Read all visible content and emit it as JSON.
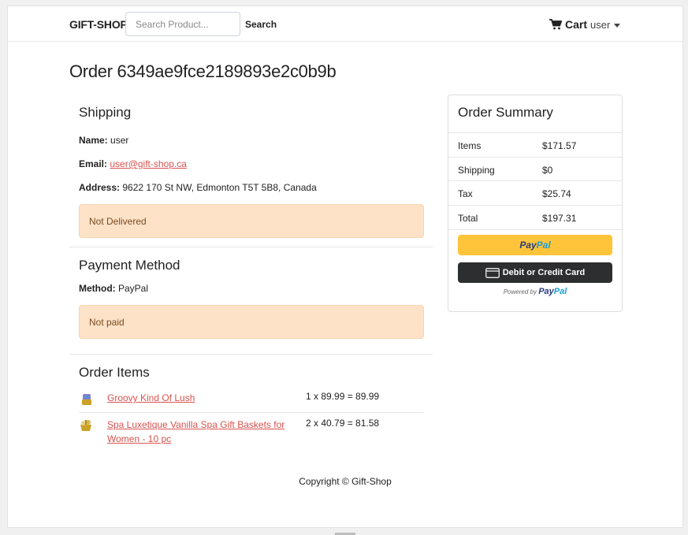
{
  "navbar": {
    "brand": "GIFT-SHOP",
    "search_placeholder": "Search Product...",
    "search_label": "Search",
    "cart_label": "Cart",
    "user_label": "user"
  },
  "order": {
    "title": "Order 6349ae9fce2189893e2c0b9b"
  },
  "shipping": {
    "heading": "Shipping",
    "name_label": "Name:",
    "name_value": "user",
    "email_label": "Email:",
    "email_value": "user@gift-shop.ca",
    "address_label": "Address:",
    "address_value": "9622 170 St NW, Edmonton T5T 5B8, Canada",
    "status": "Not Delivered"
  },
  "payment": {
    "heading": "Payment Method",
    "method_label": "Method:",
    "method_value": "PayPal",
    "status": "Not paid"
  },
  "items": {
    "heading": "Order Items",
    "list": [
      {
        "name": "Groovy Kind Of Lush",
        "calc": "1 x 89.99 = 89.99",
        "icon": "product-thumbnail"
      },
      {
        "name": "Spa Luxetique Vanilla Spa Gift Baskets for Women - 10 pc",
        "calc": "2 x 40.79 = 81.58",
        "icon": "product-thumbnail"
      }
    ]
  },
  "summary": {
    "heading": "Order Summary",
    "rows": [
      {
        "label": "Items",
        "value": "$171.57"
      },
      {
        "label": "Shipping",
        "value": "$0"
      },
      {
        "label": "Tax",
        "value": "$25.74"
      },
      {
        "label": "Total",
        "value": "$197.31"
      }
    ],
    "paypal_pay": "Pay",
    "paypal_pal": "Pal",
    "card_button": "Debit or Credit Card",
    "powered_by": "Powered by"
  },
  "footer": {
    "copyright": "Copyright © Gift-Shop"
  },
  "colors": {
    "link": "#d9534f",
    "alert_bg": "#fde2c8",
    "paypal_yellow": "#ffc439",
    "card_dark": "#2c2e2f"
  }
}
